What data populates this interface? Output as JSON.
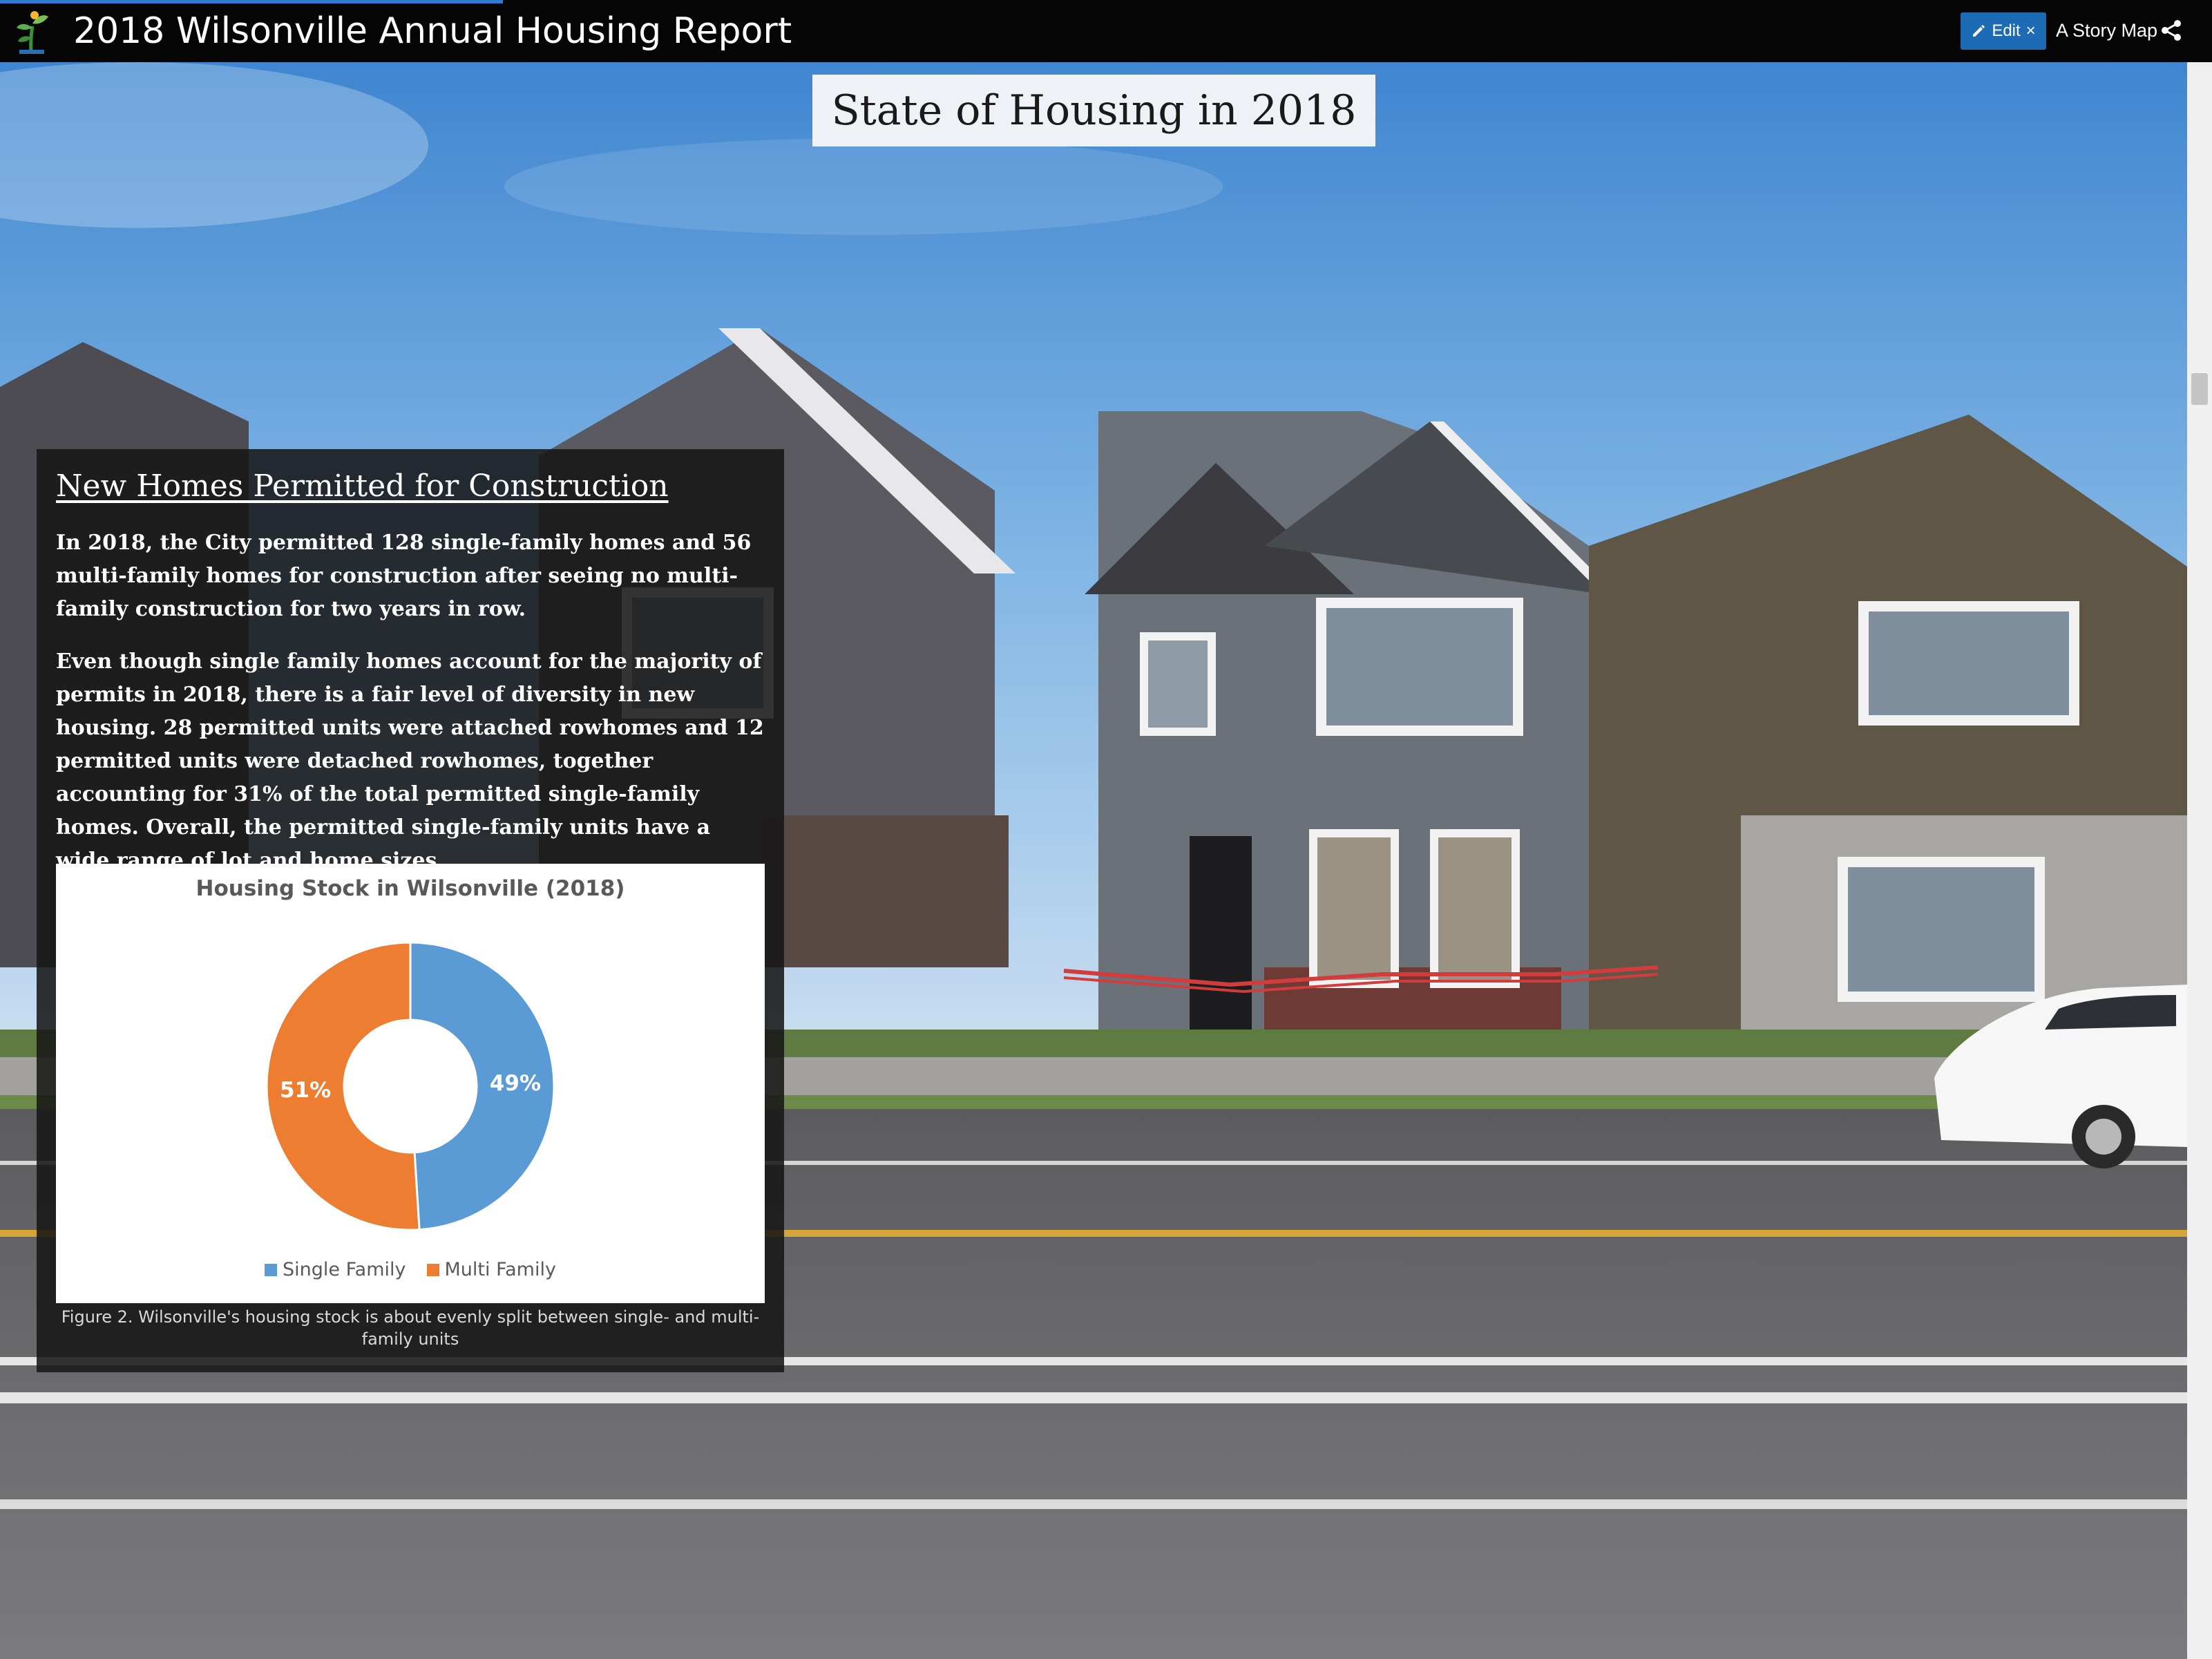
{
  "header": {
    "title": "2018 Wilsonville Annual Housing Report",
    "edit_label": "Edit",
    "story_map_label": "A Story Map"
  },
  "section": {
    "title": "State of Housing in 2018"
  },
  "panel": {
    "heading": "New Homes Permitted for Construction",
    "paragraph_1": "In 2018, the City permitted 128 single-family homes and 56 multi-family homes for construction after seeing no multi-family construction for two years in row.",
    "paragraph_2": "Even though single family homes account for the majority of permits in 2018, there is a fair level of diversity in new housing. 28 permitted units were attached rowhomes and 12 permitted units were detached rowhomes, together accounting for 31% of the total permitted single-family homes. Overall, the permitted single-family units have a wide range of lot and home sizes.",
    "caption": "Figure 2. Wilsonville's housing stock is about evenly split between single- and multi-family units"
  },
  "chart_data": {
    "type": "pie",
    "title": "Housing Stock in Wilsonville (2018)",
    "categories": [
      "Single Family",
      "Multi Family"
    ],
    "values": [
      49,
      51
    ],
    "labels": [
      "49%",
      "51%"
    ],
    "colors": [
      "#5b9bd5",
      "#ed7d31"
    ],
    "donut": true,
    "legend": "bottom"
  },
  "colors": {
    "topbar": "#050505",
    "accent": "#1e6bb5"
  },
  "icons": [
    "logo-icon",
    "pencil-icon",
    "close-icon",
    "share-icon"
  ]
}
